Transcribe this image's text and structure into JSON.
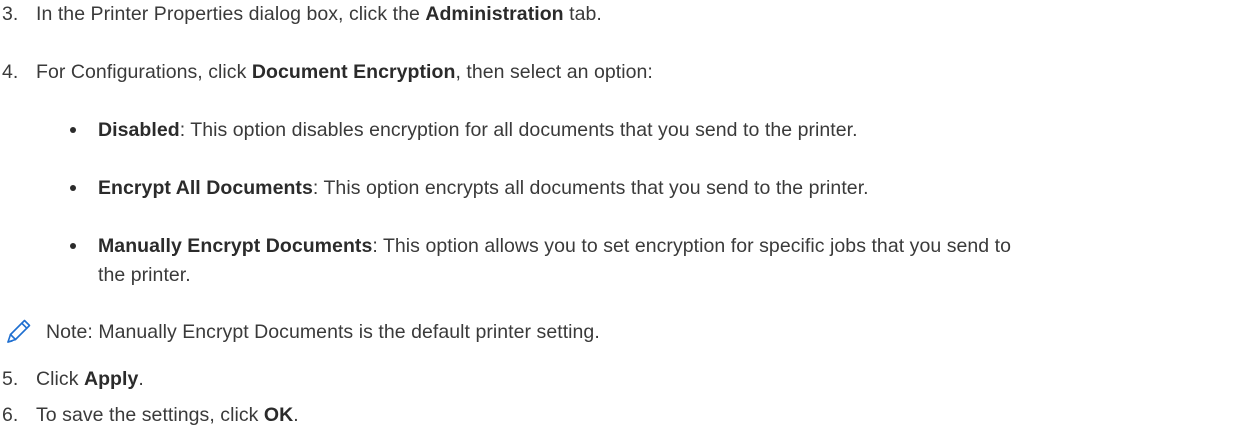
{
  "steps": [
    {
      "number": "3.",
      "pre": "In the Printer Properties dialog box, click the ",
      "bold": "Administration",
      "post": " tab."
    },
    {
      "number": "4.",
      "pre": "For Configurations, click ",
      "bold": "Document Encryption",
      "post": ", then select an option:"
    },
    {
      "number": "5.",
      "pre": "Click ",
      "bold": "Apply",
      "post": "."
    },
    {
      "number": "6.",
      "pre": "To save the settings, click ",
      "bold": "OK",
      "post": "."
    }
  ],
  "options": [
    {
      "bold": "Disabled",
      "text": ": This option disables encryption for all documents that you send to the printer."
    },
    {
      "bold": "Encrypt All Documents",
      "text": ": This option encrypts all documents that you send to the printer."
    },
    {
      "bold": "Manually Encrypt Documents",
      "text": ": This option allows you to set encryption for specific jobs that you send to",
      "text_line2": "the printer."
    }
  ],
  "note": {
    "icon": "pencil-icon",
    "text": "Note: Manually Encrypt Documents is the default printer setting.",
    "icon_color": "#1f6fd0"
  }
}
